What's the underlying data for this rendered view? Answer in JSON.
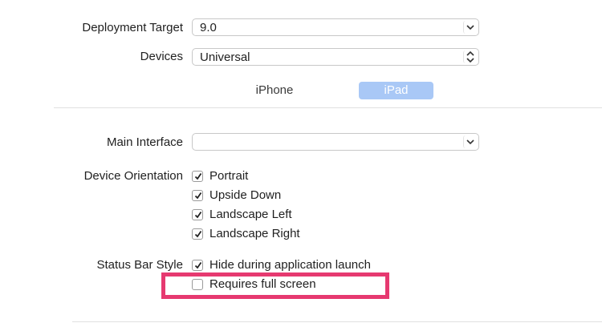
{
  "deployment": {
    "label": "Deployment Target",
    "value": "9.0"
  },
  "devices": {
    "label": "Devices",
    "value": "Universal"
  },
  "device_tabs": [
    {
      "label": "iPhone",
      "selected": false
    },
    {
      "label": "iPad",
      "selected": true
    }
  ],
  "main_interface": {
    "label": "Main Interface",
    "value": ""
  },
  "orientation": {
    "label": "Device Orientation",
    "options": [
      {
        "label": "Portrait",
        "checked": true
      },
      {
        "label": "Upside Down",
        "checked": true
      },
      {
        "label": "Landscape Left",
        "checked": true
      },
      {
        "label": "Landscape Right",
        "checked": true
      }
    ]
  },
  "status_bar": {
    "label": "Status Bar Style",
    "hide_launch": {
      "label": "Hide during application launch",
      "checked": true
    },
    "full_screen": {
      "label": "Requires full screen",
      "checked": false
    }
  },
  "colors": {
    "highlight": "#e63970",
    "selected_tab": "#a9c8f6"
  }
}
